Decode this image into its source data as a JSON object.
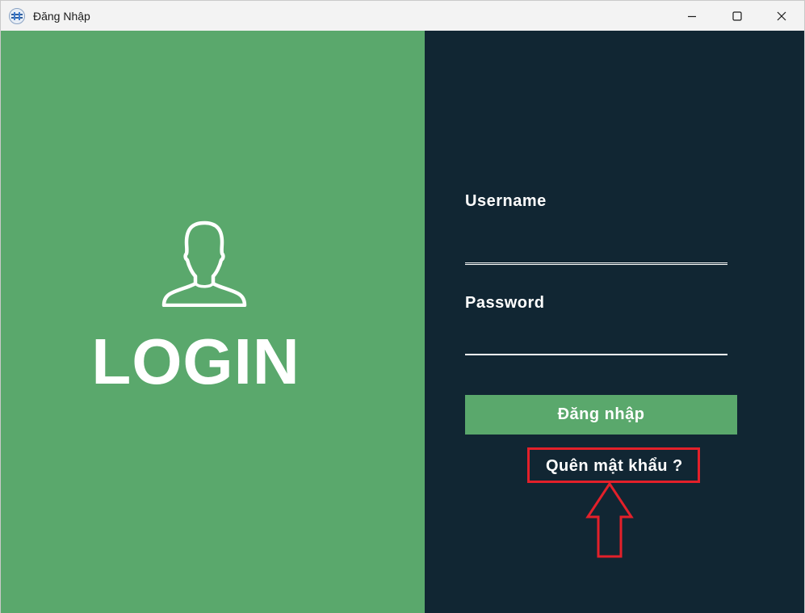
{
  "window": {
    "title": "Đăng Nhập",
    "app_icon": "app-logo-icon",
    "controls": [
      "minimize-icon",
      "maximize-icon",
      "close-icon"
    ]
  },
  "left_panel": {
    "icon": "user-outline-icon",
    "heading": "LOGIN",
    "background": "#5aa86c"
  },
  "form": {
    "background": "#112633",
    "username_label": "Username",
    "username_value": "",
    "password_label": "Password",
    "password_value": "",
    "submit_label": "Đăng nhập",
    "submit_color": "#5aa86c",
    "forgot_label": "Quên mật khẩu ?"
  },
  "annotation": {
    "highlight_color": "#e3202a",
    "arrow_icon": "up-arrow-outline-icon"
  }
}
